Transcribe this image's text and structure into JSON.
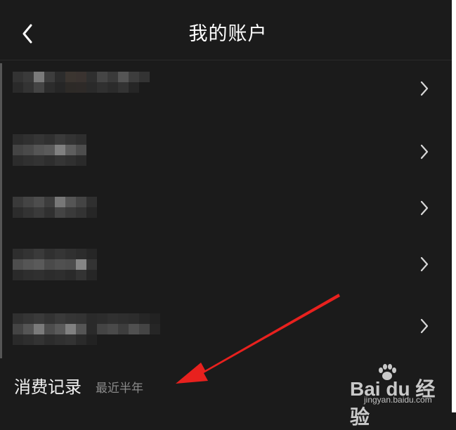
{
  "header": {
    "title": "我的账户",
    "back_icon": "chevron-left-icon"
  },
  "rows": [
    {
      "label_redacted": true,
      "chevron_icon": "chevron-right-icon"
    },
    {
      "label_redacted": true,
      "chevron_icon": "chevron-right-icon"
    },
    {
      "label_redacted": true,
      "chevron_icon": "chevron-right-icon"
    },
    {
      "label_redacted": true,
      "chevron_icon": "chevron-right-icon"
    },
    {
      "label_redacted": true,
      "chevron_icon": "chevron-right-icon"
    }
  ],
  "footer": {
    "title": "消费记录",
    "subtitle": "最近半年"
  },
  "annotation": {
    "arrow_color": "#e8211e"
  },
  "watermark": {
    "logo_text": "Bai du 经验",
    "url": "jingyan.baidu.com"
  },
  "colors": {
    "background": "#1b1b1b",
    "text": "#ffffff",
    "muted": "#8a8a8a"
  }
}
